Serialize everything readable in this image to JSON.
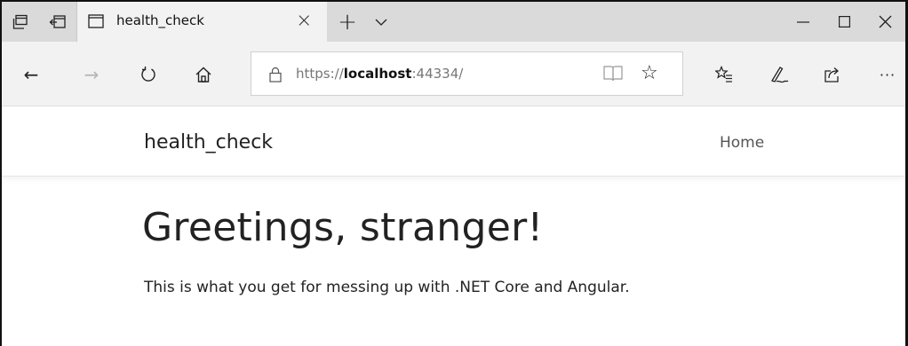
{
  "browser": {
    "tab": {
      "title": "health_check"
    },
    "address": {
      "scheme": "https://",
      "host": "localhost",
      "port_path": ":44334/"
    },
    "icons": {
      "set_aside_tabs": "set-aside-tabs-icon",
      "tabs_aside": "tabs-aside-icon",
      "tab_page": "page-icon",
      "tab_close": "close-icon",
      "new_tab": "plus-icon",
      "tab_list": "chevron-down-icon",
      "minimize": "minimize-icon",
      "maximize": "maximize-icon",
      "close_window": "close-icon",
      "back": "back-arrow-icon",
      "forward": "forward-arrow-icon",
      "refresh": "refresh-icon",
      "home": "home-icon",
      "lock": "lock-icon",
      "reading_view": "reading-view-icon",
      "favorite": "star-icon",
      "favorites": "favorites-icon",
      "notes": "pen-icon",
      "share": "share-icon",
      "more": "more-icon"
    },
    "glyphs": {
      "tab_close": "×",
      "new_tab": "+",
      "minimize": "–",
      "close": "×",
      "back": "←",
      "forward": "→",
      "refresh": "↻",
      "favorite": "☆",
      "more": "···"
    },
    "colors": {
      "tabbar": "#dadada",
      "toolbar": "#f2f2f2",
      "forward_disabled": "#b5b5b5"
    }
  },
  "page": {
    "navbar": {
      "brand": "health_check",
      "home_link": "Home"
    },
    "main": {
      "heading": "Greetings, stranger!",
      "lead": "This is what you get for messing up with .NET Core and Angular."
    }
  }
}
